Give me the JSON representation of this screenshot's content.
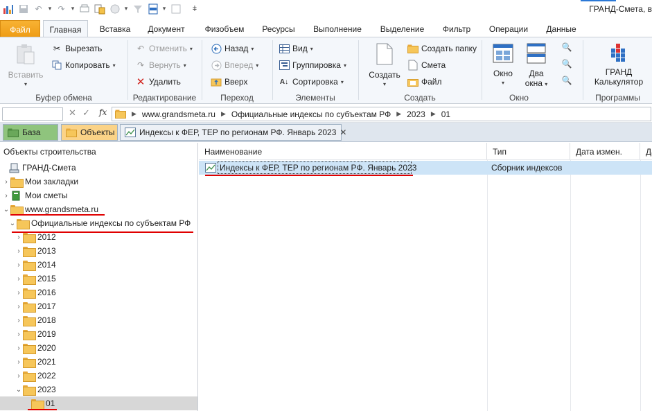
{
  "app": {
    "title": "ГРАНД-Смета, в"
  },
  "qat": {
    "icons": [
      "app-logo-icon",
      "save-icon",
      "undo-icon",
      "redo-icon",
      "print-icon",
      "import-icon",
      "calculator-icon",
      "filter-icon",
      "panel-icon",
      "color-icon"
    ]
  },
  "ribbon_tabs": [
    "Файл",
    "Главная",
    "Вставка",
    "Документ",
    "Физобъем",
    "Ресурсы",
    "Выполнение",
    "Выделение",
    "Фильтр",
    "Операции",
    "Данные"
  ],
  "groups": {
    "clipboard": {
      "label": "Буфер обмена",
      "paste": "Вставить",
      "cut": "Вырезать",
      "copy": "Копировать"
    },
    "edit": {
      "label": "Редактирование",
      "undo": "Отменить",
      "redo": "Вернуть",
      "delete": "Удалить"
    },
    "nav": {
      "label": "Переход",
      "back": "Назад",
      "forward": "Вперед",
      "up": "Вверх"
    },
    "elements": {
      "label": "Элементы",
      "view": "Вид",
      "grouping": "Группировка",
      "sort": "Сортировка"
    },
    "create": {
      "label": "Создать",
      "create": "Создать",
      "new_folder": "Создать папку",
      "estimate": "Смета",
      "file": "Файл"
    },
    "window": {
      "label": "Окно",
      "window": "Окно",
      "two_windows_1": "Два",
      "two_windows_2": "окна"
    },
    "programs": {
      "label": "Программы",
      "calc_1": "ГРАНД",
      "calc_2": "Калькулятор"
    }
  },
  "address": {
    "crumbs": [
      "www.grandsmeta.ru",
      "Официальные индексы по субъектам РФ",
      "2023",
      "01"
    ]
  },
  "doc_tabs": {
    "base": "База",
    "objects": "Объекты",
    "indexes": "Индексы к ФЕР, ТЕР по регионам РФ. Январь 2023"
  },
  "tree": {
    "header": "Объекты строительства",
    "root": "ГРАНД-Смета",
    "bookmarks": "Мои закладки",
    "my_estimates": "Мои сметы",
    "site": "www.grandsmeta.ru",
    "official": "Официальные индексы по субъектам РФ",
    "years": [
      "2012",
      "2013",
      "2014",
      "2015",
      "2016",
      "2017",
      "2018",
      "2019",
      "2020",
      "2021",
      "2022",
      "2023"
    ],
    "selected_month": "01"
  },
  "list": {
    "columns": [
      "Наименование",
      "Тип",
      "Дата измен.",
      "Да"
    ],
    "rows": [
      {
        "name": "Индексы к ФЕР, ТЕР по регионам РФ. Январь 2023",
        "type": "Сборник индексов",
        "date": ""
      }
    ]
  },
  "colors": {
    "file_tab": "#f0a11c",
    "selection": "#cde4f7",
    "annotation": "#e00000",
    "base_tab": "#8fc47d",
    "objects_tab": "#fbd387"
  }
}
